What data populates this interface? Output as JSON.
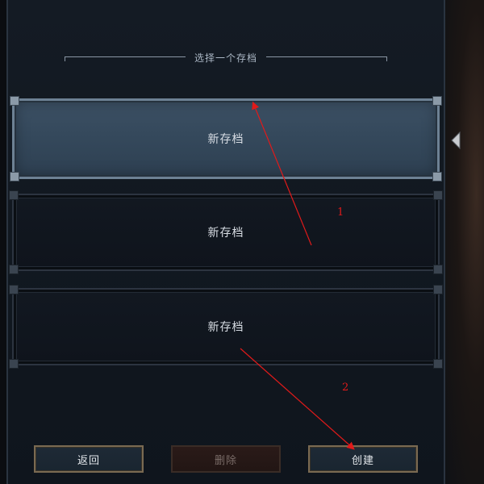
{
  "header": {
    "title": "选择一个存档"
  },
  "slots": [
    {
      "label": "新存档",
      "state": "selected"
    },
    {
      "label": "新存档",
      "state": "empty"
    },
    {
      "label": "新存档",
      "state": "empty"
    }
  ],
  "buttons": {
    "back": "返回",
    "delete": "删除",
    "create": "创建"
  },
  "annotations": [
    {
      "label": "1"
    },
    {
      "label": "2"
    }
  ],
  "colors": {
    "annotation": "#e01a1a",
    "selected_slot": "#3c5064",
    "button_border": "#7a6a52"
  }
}
